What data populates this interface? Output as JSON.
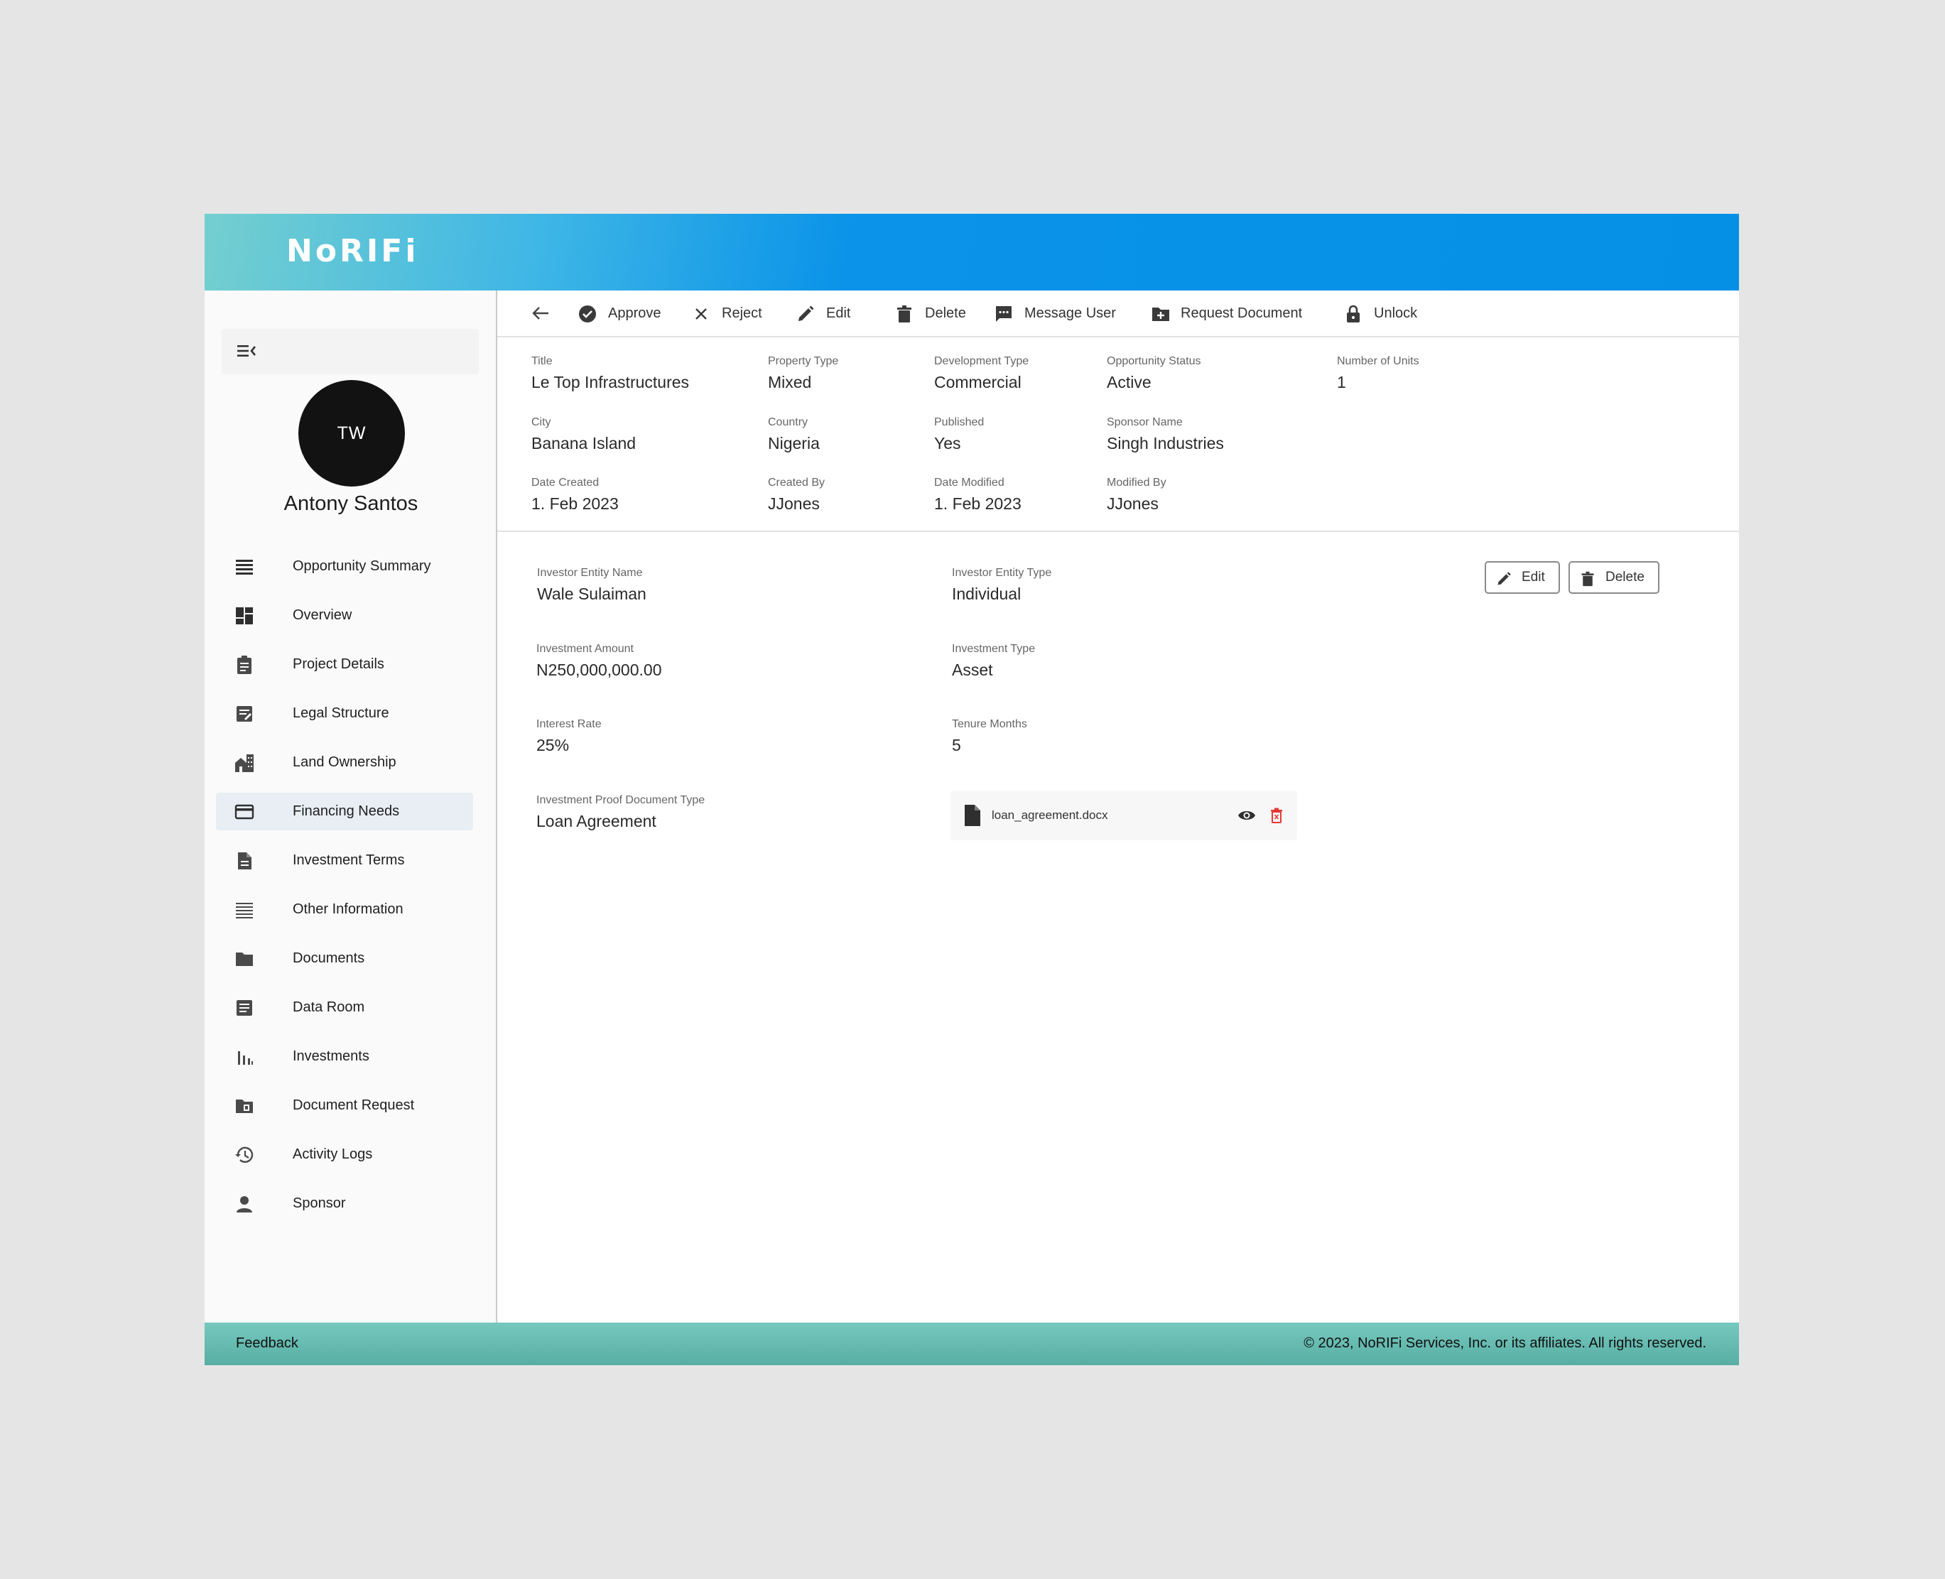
{
  "brand": {
    "logo_text": "NoRIFi"
  },
  "user": {
    "initials": "TW",
    "name": "Antony Santos"
  },
  "sidebar": {
    "items": [
      {
        "label": "Opportunity Summary",
        "icon": "list-icon"
      },
      {
        "label": "Overview",
        "icon": "dashboard-icon"
      },
      {
        "label": "Project Details",
        "icon": "clipboard-icon"
      },
      {
        "label": "Legal Structure",
        "icon": "note-edit-icon"
      },
      {
        "label": "Land Ownership",
        "icon": "buildings-icon"
      },
      {
        "label": "Financing Needs",
        "icon": "credit-card-icon",
        "active": true
      },
      {
        "label": "Investment Terms",
        "icon": "document-icon"
      },
      {
        "label": "Other Information",
        "icon": "lines-icon"
      },
      {
        "label": "Documents",
        "icon": "folder-icon"
      },
      {
        "label": "Data Room",
        "icon": "article-icon"
      },
      {
        "label": "Investments",
        "icon": "bar-chart-icon"
      },
      {
        "label": "Document Request",
        "icon": "folder-file-icon"
      },
      {
        "label": "Activity Logs",
        "icon": "history-icon"
      },
      {
        "label": "Sponsor",
        "icon": "person-icon"
      }
    ]
  },
  "toolbar": {
    "approve": "Approve",
    "reject": "Reject",
    "edit": "Edit",
    "delete": "Delete",
    "message_user": "Message User",
    "request_document": "Request Document",
    "unlock": "Unlock"
  },
  "summary": {
    "title": {
      "label": "Title",
      "value": "Le Top Infrastructures"
    },
    "property_type": {
      "label": "Property Type",
      "value": "Mixed"
    },
    "development_type": {
      "label": "Development Type",
      "value": "Commercial"
    },
    "opportunity_status": {
      "label": "Opportunity Status",
      "value": "Active"
    },
    "number_of_units": {
      "label": "Number of Units",
      "value": "1"
    },
    "city": {
      "label": "City",
      "value": "Banana Island"
    },
    "country": {
      "label": "Country",
      "value": "Nigeria"
    },
    "published": {
      "label": "Published",
      "value": "Yes"
    },
    "sponsor_name": {
      "label": "Sponsor Name",
      "value": "Singh Industries"
    },
    "date_created": {
      "label": "Date Created",
      "value": "1. Feb 2023"
    },
    "created_by": {
      "label": "Created By",
      "value": "JJones"
    },
    "date_modified": {
      "label": "Date Modified",
      "value": "1. Feb 2023"
    },
    "modified_by": {
      "label": "Modified By",
      "value": "JJones"
    }
  },
  "investment": {
    "entity_name": {
      "label": "Investor Entity Name",
      "value": "Wale Sulaiman"
    },
    "entity_type": {
      "label": "Investor Entity Type",
      "value": "Individual"
    },
    "amount": {
      "label": "Investment Amount",
      "value": "N250,000,000.00"
    },
    "type": {
      "label": "Investment Type",
      "value": "Asset"
    },
    "interest_rate": {
      "label": "Interest Rate",
      "value": "25%"
    },
    "tenure": {
      "label": "Tenure Months",
      "value": "5"
    },
    "proof_doc_type": {
      "label": "Investment Proof Document Type",
      "value": "Loan Agreement"
    },
    "document": {
      "filename": "loan_agreement.docx"
    },
    "edit_label": "Edit",
    "delete_label": "Delete"
  },
  "footer": {
    "feedback": "Feedback",
    "copyright": "© 2023, NoRIFi Services, Inc. or its affiliates. All rights reserved."
  },
  "colors": {
    "header_blue": "#0590e6",
    "header_teal": "#74cfcf",
    "footer_teal": "#58aea2",
    "active_nav": "#e8eef3",
    "danger": "#e53935"
  }
}
